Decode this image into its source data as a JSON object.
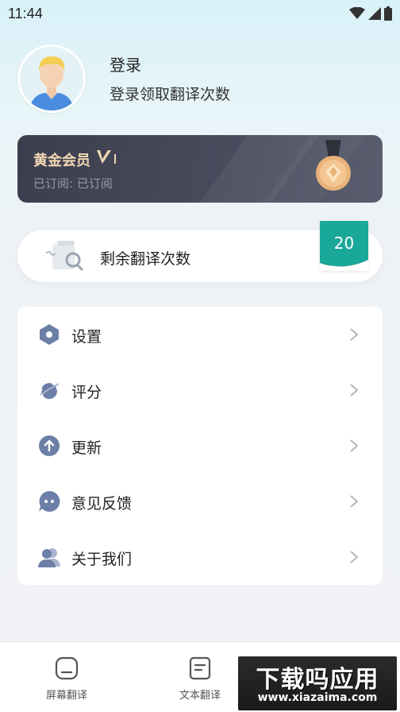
{
  "status_bar": {
    "time": "11:44"
  },
  "profile": {
    "title": "登录",
    "subtitle": "登录领取翻译次数"
  },
  "vip": {
    "title": "黄金会员",
    "status": "已订阅: 已订阅"
  },
  "remaining": {
    "label": "剩余翻译次数",
    "count": "20"
  },
  "menu": {
    "items": [
      {
        "label": "设置",
        "icon": "gear-icon"
      },
      {
        "label": "评分",
        "icon": "planet-icon"
      },
      {
        "label": "更新",
        "icon": "arrow-up-icon"
      },
      {
        "label": "意见反馈",
        "icon": "chat-bubble-icon"
      },
      {
        "label": "关于我们",
        "icon": "users-icon"
      }
    ]
  },
  "bottom_nav": {
    "items": [
      {
        "label": "屏幕翻译",
        "icon": "screen-icon"
      },
      {
        "label": "文本翻译",
        "icon": "document-icon"
      }
    ]
  },
  "watermark": {
    "title": "下载吗应用",
    "url": "www.xiazaima.com"
  },
  "colors": {
    "accent": "#1aa89a",
    "icon_blue": "#6c7fa6",
    "vip_gold": "#f2d8b2",
    "vip_bg": "#434756"
  }
}
